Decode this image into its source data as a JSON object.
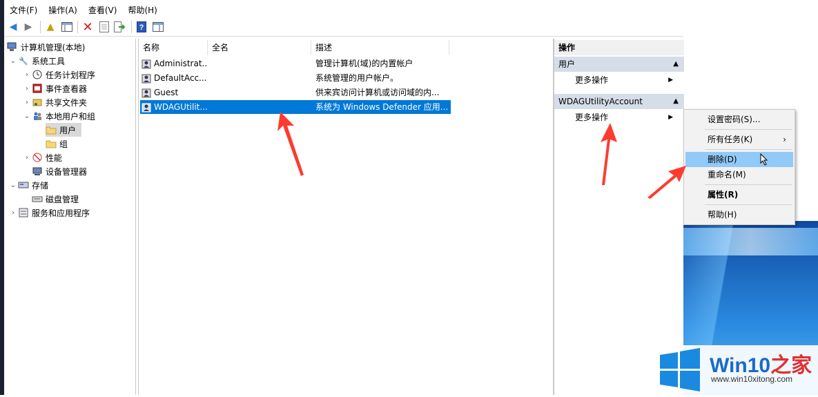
{
  "menubar": [
    "文件(F)",
    "操作(A)",
    "查看(V)",
    "帮助(H)"
  ],
  "toolbar": [
    "back-icon",
    "forward-icon",
    "up-folder-icon",
    "show-hide-tree-icon",
    "delete-icon",
    "properties-icon",
    "export-icon",
    "help-icon",
    "show-action-pane-icon"
  ],
  "tree": {
    "root": "计算机管理(本地)",
    "system_tools": "系统工具",
    "task_scheduler": "任务计划程序",
    "event_viewer": "事件查看器",
    "shared_folders": "共享文件夹",
    "local_users_groups": "本地用户和组",
    "users": "用户",
    "groups": "组",
    "performance": "性能",
    "device_manager": "设备管理器",
    "storage": "存储",
    "disk_management": "磁盘管理",
    "services_apps": "服务和应用程序"
  },
  "list": {
    "headers": {
      "name": "名称",
      "fullname": "全名",
      "desc": "描述"
    },
    "rows": [
      {
        "name": "Administrat...",
        "fullname": "",
        "desc": "管理计算机(域)的内置帐户"
      },
      {
        "name": "DefaultAcc...",
        "fullname": "",
        "desc": "系统管理的用户帐户。"
      },
      {
        "name": "Guest",
        "fullname": "",
        "desc": "供来宾访问计算机或访问域的内..."
      },
      {
        "name": "WDAGUtilit...",
        "fullname": "",
        "desc": "系统为 Windows Defender 应用..."
      }
    ]
  },
  "actions": {
    "title": "操作",
    "section1": "用户",
    "more1": "更多操作",
    "section2": "WDAGUtilityAccount",
    "more2": "更多操作"
  },
  "context_menu": {
    "set_password": "设置密码(S)...",
    "all_tasks": "所有任务(K)",
    "delete": "删除(D)",
    "rename": "重命名(M)",
    "properties": "属性(R)",
    "help": "帮助(H)"
  },
  "watermark": {
    "brand": "Win10",
    "brand_suffix": "之家",
    "url": "www.win10xitong.com"
  },
  "colors": {
    "selection": "#0078d7",
    "menu_highlight": "#91c9f7",
    "arrow": "#ff3b2f",
    "action_header": "#d5dde8"
  }
}
